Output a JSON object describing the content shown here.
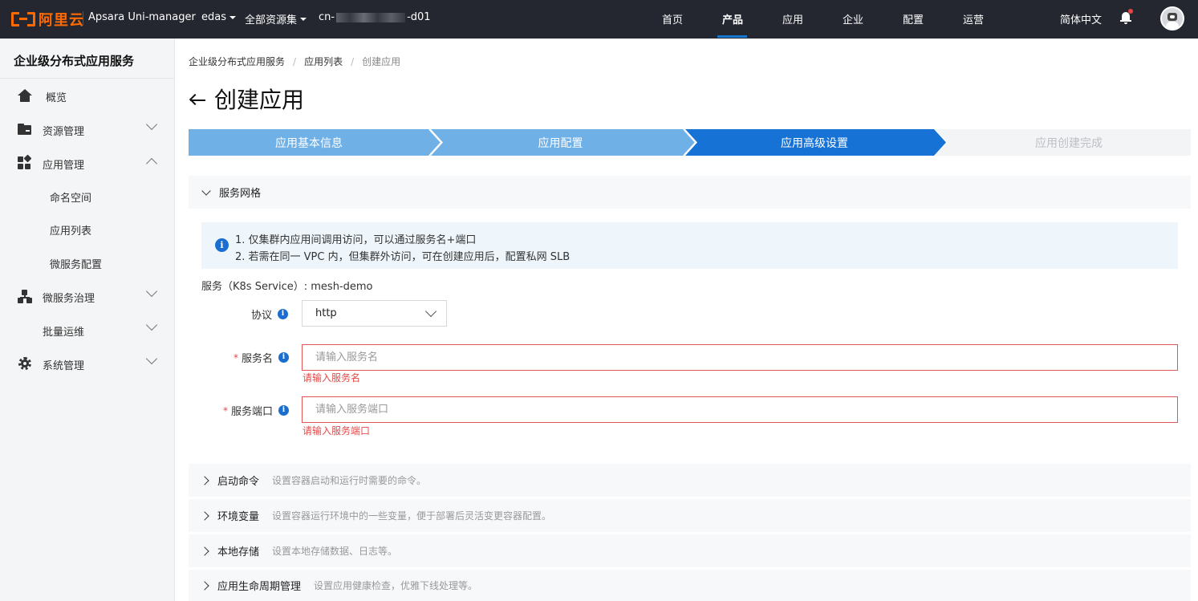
{
  "topbar": {
    "logo_text": "阿里云",
    "product_name": "Apsara Uni-manager",
    "dropdowns": {
      "edas": "edas",
      "resource_set": "全部资源集",
      "region_prefix": "cn-",
      "region_suffix": "-d01"
    },
    "nav": [
      "首页",
      "产品",
      "应用",
      "企业",
      "配置",
      "运营"
    ],
    "active_nav": "产品",
    "language": "简体中文",
    "accent_color": "#ff6a00"
  },
  "sidebar": {
    "title": "企业级分布式应用服务",
    "items": [
      {
        "label": "概览",
        "icon": "home-icon"
      },
      {
        "label": "资源管理",
        "icon": "folder-icon"
      },
      {
        "label": "应用管理",
        "icon": "grid-icon"
      },
      {
        "label": "命名空间"
      },
      {
        "label": "应用列表"
      },
      {
        "label": "微服务配置"
      },
      {
        "label": "微服务治理",
        "icon": "nodes-icon"
      },
      {
        "label": "批量运维"
      },
      {
        "label": "系统管理",
        "icon": "gear-icon"
      }
    ]
  },
  "breadcrumb": [
    "企业级分布式应用服务",
    "应用列表",
    "创建应用"
  ],
  "page": {
    "title": "创建应用"
  },
  "steps": [
    "应用基本信息",
    "应用配置",
    "应用高级设置",
    "应用创建完成"
  ],
  "active_step": 3,
  "service_mesh": {
    "title": "服务网格",
    "info_lines": [
      "1. 仅集群内应用间调用访问，可以通过服务名+端口",
      "2. 若需在同一 VPC 内，但集群外访问，可在创建应用后，配置私网 SLB"
    ],
    "service_label": "服务（K8s Service）: mesh-demo",
    "protocol": {
      "label": "协议",
      "value": "http"
    },
    "service_name": {
      "label": "服务名",
      "required_mark": "*",
      "placeholder": "请输入服务名",
      "error": "请输入服务名"
    },
    "service_port": {
      "label": "服务端口",
      "required_mark": "*",
      "placeholder": "请输入服务端口",
      "error": "请输入服务端口"
    }
  },
  "panels": [
    {
      "title": "启动命令",
      "desc": "设置容器启动和运行时需要的命令。"
    },
    {
      "title": "环境变量",
      "desc": "设置容器运行环境中的一些变量，便于部署后灵活变更容器配置。"
    },
    {
      "title": "本地存储",
      "desc": "设置本地存储数据、日志等。"
    },
    {
      "title": "应用生命周期管理",
      "desc": "设置应用健康检查，优雅下线处理等。"
    }
  ],
  "colors": {
    "step_done": "#6fb0e6",
    "step_active": "#1672d4",
    "step_pending": "#f3f4f6",
    "error": "#e24b4b",
    "info": "#1a6ed0"
  }
}
